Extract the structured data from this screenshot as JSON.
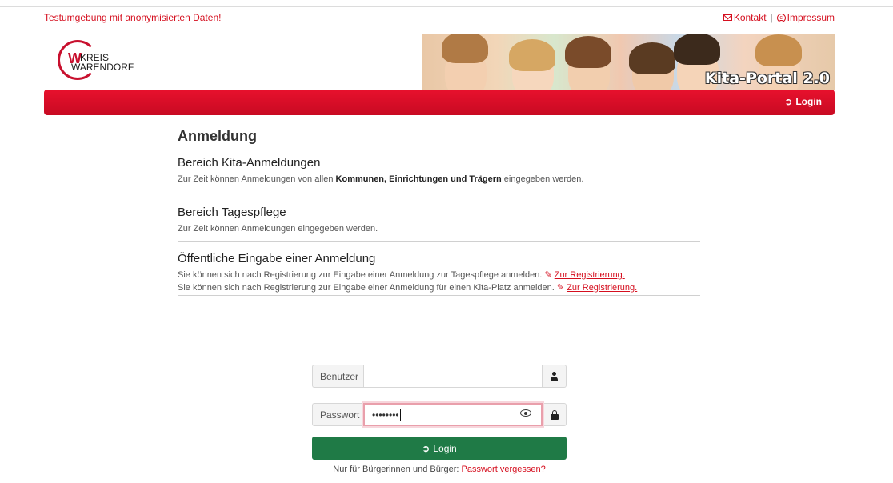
{
  "top": {
    "test_banner": "Testumgebung mit anonymisierten Daten!",
    "contact_label": "Kontakt",
    "separator": "|",
    "imprint_label": "Impressum"
  },
  "logo": {
    "line1": "KREIS",
    "line2": "WARENDORF",
    "w_letter": "W"
  },
  "hero": {
    "title": "Kita-Portal 2.0"
  },
  "navbar": {
    "login_label": "Login"
  },
  "icons": {
    "contact": "mail-icon",
    "imprint": "copyright-icon",
    "login": "sign-in-icon",
    "edit": "edit-icon",
    "user": "user-icon",
    "lock": "lock-icon",
    "eye": "eye-icon"
  },
  "colors": {
    "brand_red": "#d50f1f",
    "navbar": "#e8112d",
    "login_green": "#1f7a46",
    "focus_border": "#e99fab"
  },
  "content": {
    "heading": "Anmeldung",
    "kita": {
      "title": "Bereich Kita-Anmeldungen",
      "text_pre": "Zur Zeit können Anmeldungen von allen ",
      "text_bold": "Kommunen, Einrichtungen und Trägern",
      "text_post": " eingegeben werden."
    },
    "tagespflege": {
      "title": "Bereich Tagespflege",
      "text": "Zur Zeit können Anmeldungen eingegeben werden."
    },
    "public": {
      "title": "Öffentliche Eingabe einer Anmeldung",
      "line1_text": "Sie können sich nach Registrierung zur Eingabe einer Anmeldung zur Tagespflege anmelden.",
      "line2_text": "Sie können sich nach Registrierung zur Eingabe einer Anmeldung für einen Kita-Platz anmelden.",
      "register_link": "Zur Registrierung."
    }
  },
  "form": {
    "user_label": "Benutzer",
    "user_value": "",
    "password_label": "Passwort",
    "password_value": "••••••••",
    "login_button": "Login",
    "forgot_prefix": "Nur für ",
    "forgot_citizens": "Bürgerinnen und Bürger",
    "forgot_colon": ": ",
    "forgot_link": "Passwort vergessen?"
  }
}
